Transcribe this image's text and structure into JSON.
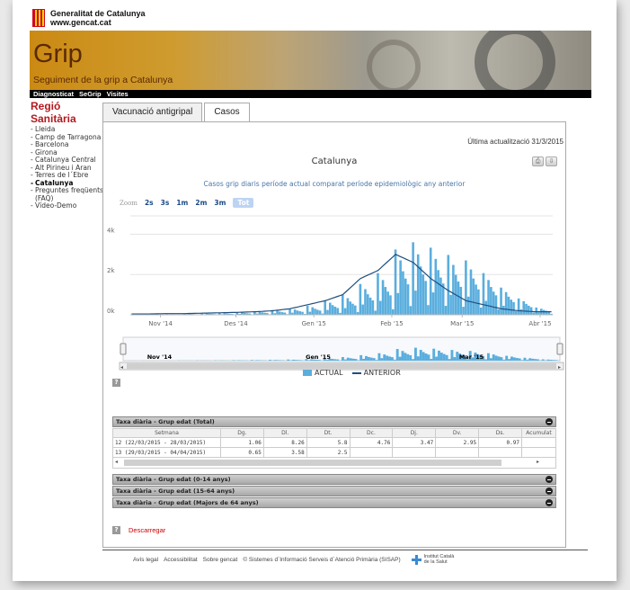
{
  "header": {
    "org_name": "Generalitat de Catalunya",
    "org_url": "www.gencat.cat",
    "site_title": "Grip",
    "site_subtitle": "Seguiment de la grip a Catalunya"
  },
  "nav": {
    "items": [
      "Diagnosticat",
      "SeGrip",
      "Visites"
    ]
  },
  "sidebar": {
    "heading": "Regió Sanitària",
    "items": [
      {
        "label": "Lleida",
        "active": false
      },
      {
        "label": "Camp de Tarragona",
        "active": false
      },
      {
        "label": "Barcelona",
        "active": false
      },
      {
        "label": "Girona",
        "active": false
      },
      {
        "label": "Catalunya Central",
        "active": false
      },
      {
        "label": "Alt Pirineu i Aran",
        "active": false
      },
      {
        "label": "Terres de l´Ebre",
        "active": false
      },
      {
        "label": "Catalunya",
        "active": true
      },
      {
        "label": "Preguntes freqüents (FAQ)",
        "active": false
      },
      {
        "label": "Vídeo-Demo",
        "active": false
      }
    ]
  },
  "tabs": [
    {
      "label": "Vacunació antigripal",
      "active": false
    },
    {
      "label": "Casos",
      "active": true
    }
  ],
  "panel": {
    "last_update": "Última actualització 31/3/2015",
    "zoom_label": "Zoom",
    "zoom_buttons": [
      "2s",
      "3s",
      "1m",
      "2m",
      "3m",
      "Tot"
    ],
    "help_icon": "?",
    "download_label": "Descarregar"
  },
  "chart_data": {
    "type": "bar",
    "title": "Catalunya",
    "subtitle": "Casos grip diaris període actual comparat període epidemiològic any anterior",
    "y_ticks": [
      "0k",
      "2k",
      "4k"
    ],
    "ylim": [
      0,
      5000
    ],
    "x_ticks": [
      "Nov '14",
      "Des '14",
      "Gen '15",
      "Feb '15",
      "Mar '15",
      "Abr '15"
    ],
    "navigator_labels": [
      "Nov '14",
      "Gen '15",
      "Mar '15"
    ],
    "x_start": "2014-10-20",
    "series": [
      {
        "name": "ACTUAL",
        "color": "#5aaede",
        "type": "bar",
        "weekly_peaks": [
          20,
          30,
          40,
          60,
          80,
          100,
          150,
          200,
          260,
          350,
          500,
          800,
          1100,
          1700,
          2300,
          3600,
          4000,
          3700,
          3300,
          3000,
          2300,
          1500,
          900,
          400
        ]
      },
      {
        "name": "ANTERIOR",
        "color": "#1f4f80",
        "type": "line",
        "weekly_values": [
          40,
          40,
          60,
          60,
          80,
          100,
          120,
          150,
          200,
          300,
          500,
          700,
          1000,
          1800,
          2200,
          3000,
          2600,
          1800,
          1200,
          700,
          500,
          300,
          200,
          150
        ]
      }
    ]
  },
  "tables": [
    {
      "title": "Taxa diària - Grup edat (Total)",
      "columns": [
        "Setmana",
        "Dg.",
        "Dl.",
        "Dt.",
        "Dc.",
        "Dj.",
        "Dv.",
        "Ds.",
        "Acumulat"
      ],
      "rows": [
        [
          "12 (22/03/2015 - 28/03/2015)",
          "1.06",
          "8.26",
          "5.8",
          "4.76",
          "3.47",
          "2.95",
          "0.97",
          ""
        ],
        [
          "13 (29/03/2015 - 04/04/2015)",
          "0.65",
          "3.58",
          "2.5",
          "",
          "",
          "",
          "",
          ""
        ]
      ]
    },
    {
      "title": "Taxa diària - Grup edat (0-14 anys)"
    },
    {
      "title": "Taxa diària - Grup edat (15-64 anys)"
    },
    {
      "title": "Taxa diària - Grup edat (Majors de 64 anys)"
    }
  ],
  "footer": {
    "links": [
      "Avís legal",
      "Accessibilitat",
      "Sobre gencat",
      "© Sistemes d´Informació Serveis d´Atenció Primària (SISAP)"
    ],
    "ics_line1": "Institut Català",
    "ics_line2": "de la Salut"
  }
}
